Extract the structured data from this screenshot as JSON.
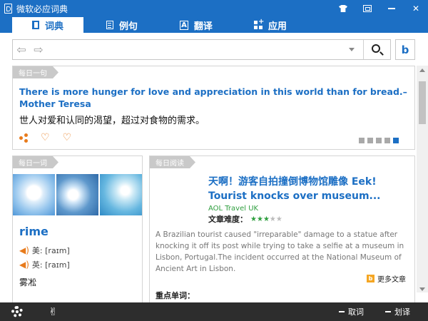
{
  "app": {
    "title": "微软必应词典"
  },
  "tabs": [
    {
      "label": "词典",
      "icon": "book-icon",
      "active": true
    },
    {
      "label": "例句",
      "icon": "document-icon",
      "active": false
    },
    {
      "label": "翻译",
      "icon": "translate-icon",
      "active": false
    },
    {
      "label": "应用",
      "icon": "apps-icon",
      "active": false
    }
  ],
  "search": {
    "value": "",
    "bing_logo": "b"
  },
  "daily_sentence": {
    "label": "每日一句",
    "english": "There is more hunger for love and appreciation in this world than for bread.– Mother Teresa",
    "chinese": "世人对爱和认同的渴望，超过对食物的需求。",
    "pages": 5,
    "current_page": 5
  },
  "daily_word": {
    "label": "每日一词",
    "word": "rime",
    "us_phonetic": "美: [raɪm]",
    "uk_phonetic": "英: [raɪm]",
    "meaning": "雾凇"
  },
  "daily_reading": {
    "label": "每日阅读",
    "title": "天啊！游客自拍撞倒博物馆雕像  Eek! Tourist knocks over museum...",
    "source": "AOL Travel UK",
    "difficulty_label": "文章难度：",
    "difficulty": 3,
    "difficulty_max": 5,
    "body": "A Brazilian tourist caused \"irreparable\" damage to a statue after knocking it off its post while trying to take a selfie at a museum in Lisbon, Portugal.The incident occurred at the National Museum of Ancient Art in Lisbon.",
    "more_label": "更多文章",
    "key_words_label": "重点单词："
  },
  "bottom_bar": {
    "left_pick_label": "取词",
    "right_pick_label": "划译"
  },
  "colors": {
    "accent": "#1c6fc4",
    "orange": "#e87b1c",
    "green": "#2e9e3e",
    "bottom_bar": "#2d2d2d"
  }
}
